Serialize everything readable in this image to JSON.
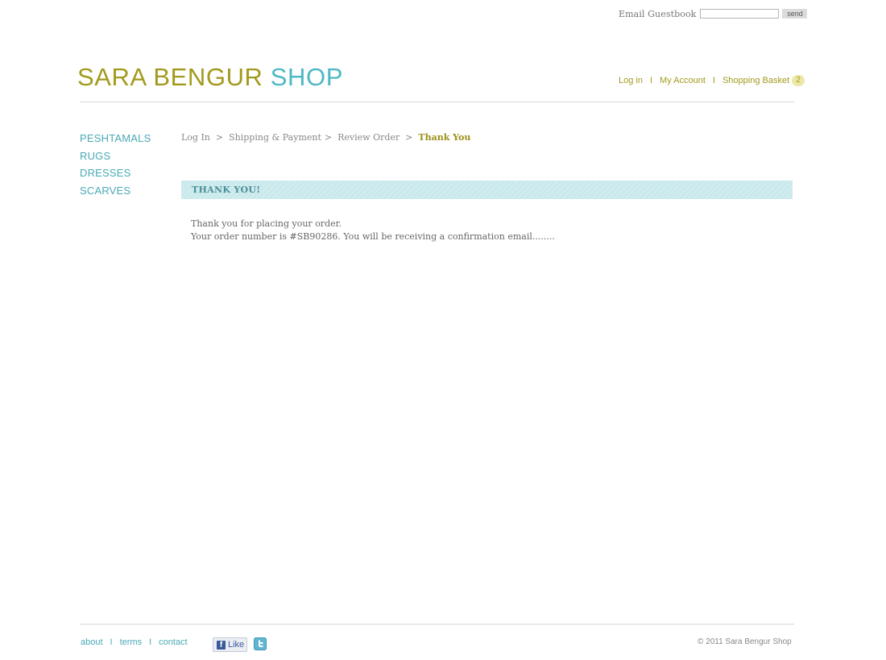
{
  "guestbook": {
    "label": "Email Guestbook",
    "input_value": "",
    "send_label": "send"
  },
  "logo": {
    "part1": "SARA BENGUR",
    "part2": "SHOP"
  },
  "account_nav": {
    "login": "Log in",
    "separator": "I",
    "my_account": "My Account",
    "basket": "Shopping Basket",
    "basket_count": "2"
  },
  "side_nav": {
    "items": [
      "PESHTAMALS",
      "RUGS",
      "DRESSES",
      "SCARVES"
    ]
  },
  "breadcrumb": {
    "steps": [
      "Log In",
      "Shipping & Payment",
      "Review Order",
      "Thank You"
    ],
    "separator": ">"
  },
  "banner": {
    "title": "THANK YOU!"
  },
  "message": {
    "line1": "Thank you for placing your order.",
    "line2": "Your order number is #SB90286. You will be receiving a confirmation email........"
  },
  "footer": {
    "links": [
      "about",
      "terms",
      "contact"
    ],
    "separator": "I",
    "like_label": "Like",
    "copyright": "© 2011 Sara Bengur Shop"
  },
  "colors": {
    "olive": "#a39a1c",
    "teal": "#4db8c4",
    "banner_bg": "#c9e9ec"
  },
  "icons": {
    "facebook": "facebook-like-icon",
    "twitter": "twitter-icon"
  }
}
